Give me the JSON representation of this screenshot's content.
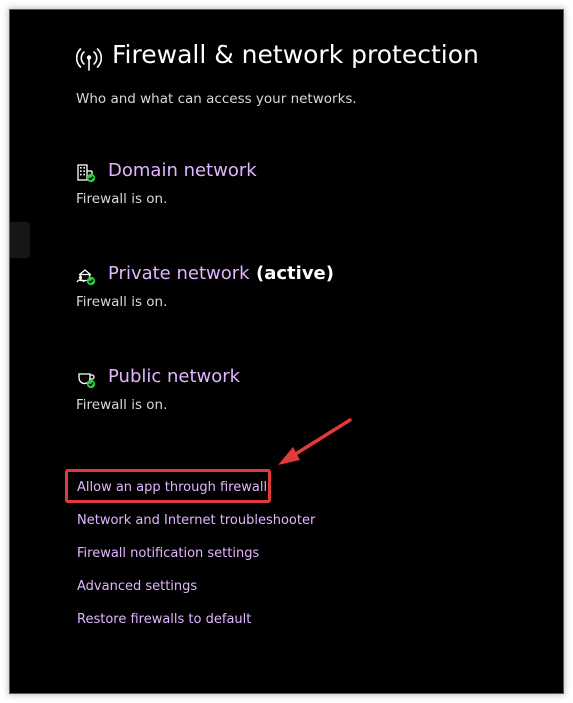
{
  "header": {
    "icon": "antenna-icon",
    "title": "Firewall & network protection",
    "subtitle": "Who and what can access your networks."
  },
  "networks": [
    {
      "icon": "domain-network-icon",
      "title": "Domain network",
      "active_label": "",
      "status": "Firewall is on."
    },
    {
      "icon": "private-network-icon",
      "title": "Private network",
      "active_label": "(active)",
      "status": "Firewall is on."
    },
    {
      "icon": "public-network-icon",
      "title": "Public network",
      "active_label": "",
      "status": "Firewall is on."
    }
  ],
  "links": [
    "Allow an app through firewall",
    "Network and Internet troubleshooter",
    "Firewall notification settings",
    "Advanced settings",
    "Restore firewalls to default"
  ],
  "colors": {
    "background": "#000000",
    "link": "#e0b6ff",
    "text": "#ffffff",
    "status_ok": "#2ecc40",
    "annotation": "#e03a3a"
  }
}
